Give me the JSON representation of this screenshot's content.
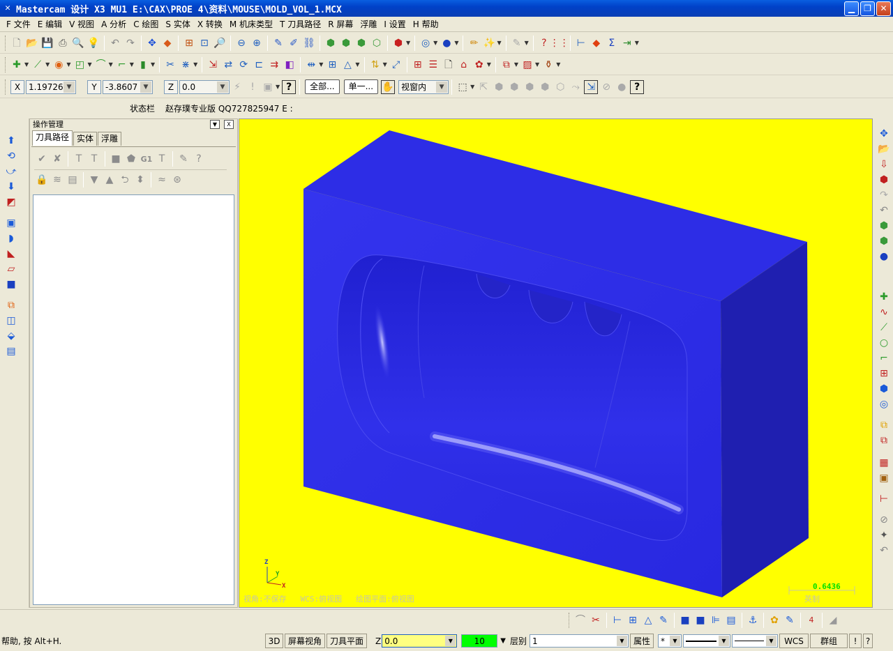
{
  "window": {
    "title": "Mastercam 设计 X3 MU1  E:\\CAX\\PROE 4\\资料\\MOUSE\\MOLD_VOL_1.MCX",
    "controls": [
      "minimize-icon",
      "maximize-icon",
      "close-icon"
    ]
  },
  "menu": [
    {
      "label": "F 文件"
    },
    {
      "label": "E 编辑"
    },
    {
      "label": "V 视图"
    },
    {
      "label": "A 分析"
    },
    {
      "label": "C 绘图"
    },
    {
      "label": "S 实体"
    },
    {
      "label": "X 转换"
    },
    {
      "label": "M 机床类型"
    },
    {
      "label": "T 刀具路径"
    },
    {
      "label": "R 屏幕"
    },
    {
      "label": "浮雕"
    },
    {
      "label": "I 设置"
    },
    {
      "label": "H 帮助"
    }
  ],
  "coordbar": {
    "x_label": "X",
    "x_value": "1.19726",
    "y_label": "Y",
    "y_value": "-3.8607",
    "z_label": "Z",
    "z_value": "0.0",
    "all_button": "全部...",
    "single_button": "单一...",
    "selection_mode": "视窗内"
  },
  "statusline": {
    "label": "状态栏",
    "text": "赵存璞专业版 QQ727825947 E :"
  },
  "opmgr": {
    "title": "操作管理",
    "tabs": [
      "刀具路径",
      "实体",
      "浮雕"
    ],
    "active_tab": "刀具路径"
  },
  "viewport": {
    "background": "#ffff00",
    "model_color": "#2a2ae8",
    "axis": {
      "z": "Z",
      "y": "Y",
      "x": "X"
    },
    "view_label": "视角:不保存",
    "wcs_label": "WCS:俯视图",
    "plane_label": "绘图平面:俯视图",
    "scale_value": "0.6436",
    "scale_unit": "英制"
  },
  "statusbar": {
    "help": "帮助, 按 Alt+H.",
    "btn_3d": "3D",
    "btn_screen_view": "屏幕视角",
    "btn_tool_plane": "刀具平面",
    "z_label": "Z",
    "z_value": "0.0",
    "color_value": "10",
    "layer_label": "层别",
    "layer_value": "1",
    "attr_label": "属性",
    "point_style": "*",
    "wcs_button": "WCS",
    "group_button": "群组",
    "bang": "!",
    "question": "?"
  }
}
